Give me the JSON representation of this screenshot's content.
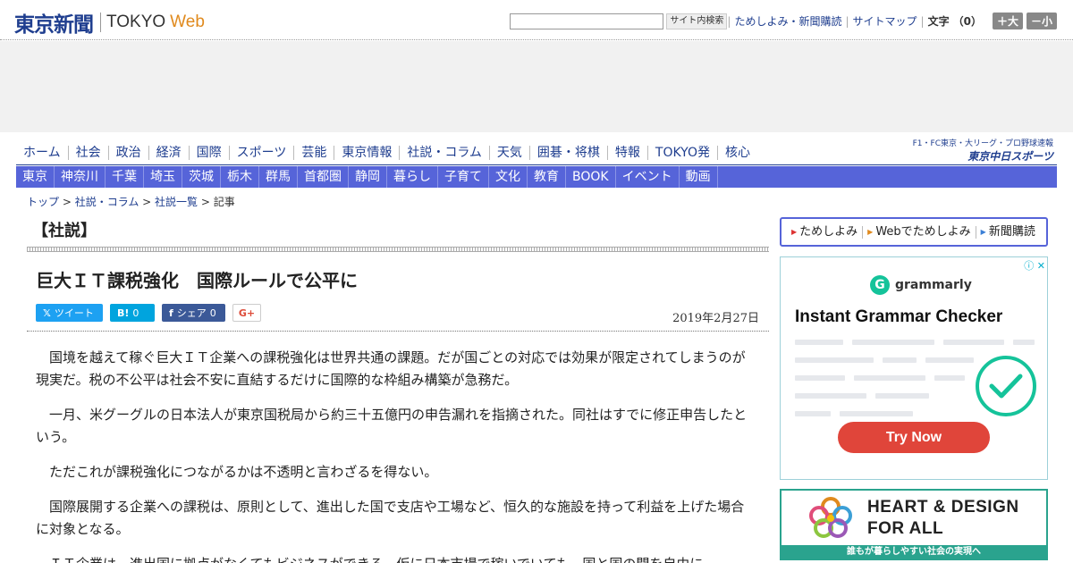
{
  "header": {
    "logo_jp": "東京新聞",
    "logo_en": "TOKYO",
    "logo_web": "Web",
    "search_button": "サイト内検索",
    "links": [
      "ためしよみ・新聞購読",
      "サイトマップ"
    ],
    "font_size_label": "文字",
    "font_size_value": "（0）",
    "font_up": "＋大",
    "font_down": "－小"
  },
  "nav_primary": [
    "ホーム",
    "社会",
    "政治",
    "経済",
    "国際",
    "スポーツ",
    "芸能",
    "東京情報",
    "社説・コラム",
    "天気",
    "囲碁・将棋",
    "特報",
    "TOKYO発",
    "核心"
  ],
  "chunichi": {
    "tagline": "F1・FC東京・大リーグ・プロ野球速報",
    "name": "東京中日スポーツ"
  },
  "nav_secondary": [
    "東京",
    "神奈川",
    "千葉",
    "埼玉",
    "茨城",
    "栃木",
    "群馬",
    "首都圏",
    "静岡",
    "暮らし",
    "子育て",
    "文化",
    "教育",
    "BOOK",
    "イベント",
    "動画"
  ],
  "breadcrumb": {
    "items": [
      "トップ",
      "社説・コラム",
      "社説一覧"
    ],
    "current": "記事",
    "sep": " > "
  },
  "article": {
    "section": "【社説】",
    "title": "巨大ＩＴ課税強化　国際ルールで公平に",
    "date": "2019年2月27日",
    "share": {
      "tweet": "ツイート",
      "hatena_count": "0",
      "facebook": "シェア",
      "facebook_count": "0",
      "gplus": "G+"
    },
    "paragraphs": [
      "国境を越えて稼ぐ巨大ＩＴ企業への課税強化は世界共通の課題。だが国ごとの対応では効果が限定されてしまうのが現実だ。税の不公平は社会不安に直結するだけに国際的な枠組み構築が急務だ。",
      "一月、米グーグルの日本法人が東京国税局から約三十五億円の申告漏れを指摘された。同社はすでに修正申告したという。",
      "ただこれが課税強化につながるかは不透明と言わざるを得ない。",
      "国際展開する企業への課税は、原則として、進出した国で支店や工場など、恒久的な施設を持って利益を上げた場合に対象となる。",
      "ＩＴ企業は、進出国に拠点がなくてもビジネスができる。仮に日本市場で稼いでいても、国と国の間を自由に"
    ]
  },
  "sidebar": {
    "menu": [
      "ためしよみ",
      "Webでためしよみ",
      "新聞購読"
    ],
    "ad": {
      "brand": "grammarly",
      "headline": "Instant Grammar Checker",
      "cta": "Try Now"
    },
    "banner": {
      "line1": "HEART & DESIGN",
      "line2": "FOR ALL",
      "footer": "誰もが暮らしやすい社会の実現へ"
    }
  },
  "colors": {
    "brand_blue": "#1f3e8f",
    "nav_blue": "#5664d9",
    "accent_orange": "#e08a1e",
    "grammarly_green": "#15c39a",
    "cta_red": "#e0453a",
    "banner_teal": "#2aa38e"
  }
}
